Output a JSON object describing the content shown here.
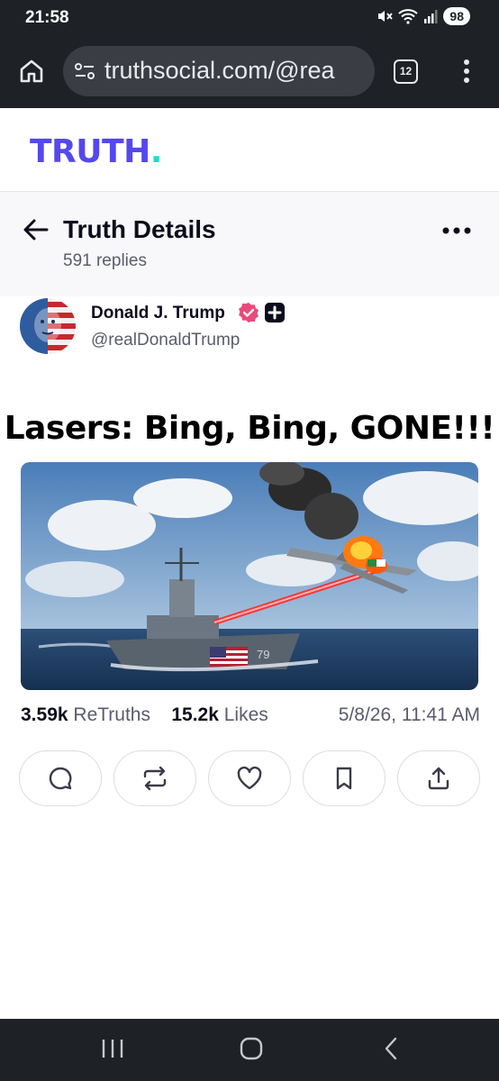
{
  "status_bar": {
    "time": "21:58",
    "battery": "98"
  },
  "browser": {
    "url": "truthsocial.com/@rea",
    "tab_count": "12"
  },
  "brand": {
    "logo_text": "TRUTH",
    "logo_dot": ".",
    "logo_color": "#5448ee",
    "accent_color": "#19e0c8"
  },
  "header": {
    "title": "Truth Details",
    "replies": "591 replies"
  },
  "author": {
    "name": "Donald J. Trump",
    "handle": "@realDonaldTrump"
  },
  "post": {
    "title": "Lasers: Bing, Bing, GONE!!!",
    "image_hull_number": "79"
  },
  "stats": {
    "retruths_count": "3.59k",
    "retruths_label": "ReTruths",
    "likes_count": "15.2k",
    "likes_label": "Likes",
    "date": "5/8/26, 11:41 AM"
  },
  "actions": [
    "reply-icon",
    "retruth-icon",
    "like-icon",
    "bookmark-icon",
    "share-icon"
  ]
}
